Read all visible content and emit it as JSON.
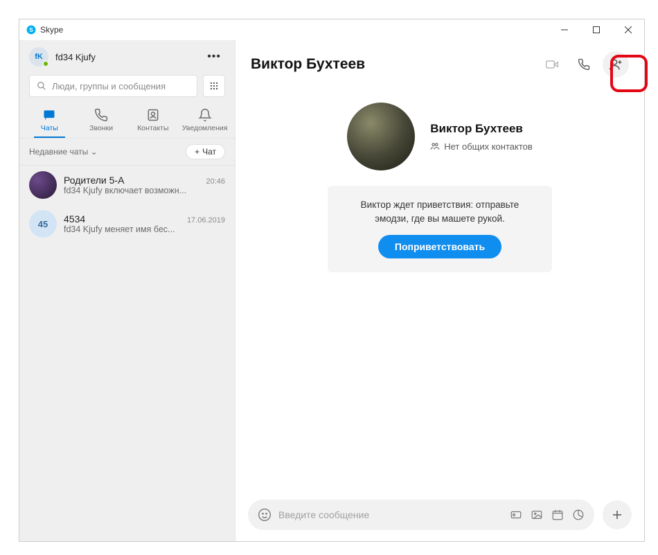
{
  "window": {
    "title": "Skype"
  },
  "sidebar": {
    "user": {
      "initials": "fK",
      "name": "fd34 Kjufy"
    },
    "search_placeholder": "Люди, группы и сообщения",
    "tabs": {
      "chats": "Чаты",
      "calls": "Звонки",
      "contacts": "Контакты",
      "notifications": "Уведомления"
    },
    "recent_label": "Недавние чаты",
    "new_chat_label": "Чат",
    "items": [
      {
        "avatar_text": "",
        "name": "Родители 5-А",
        "time": "20:46",
        "preview": "fd34 Kjufy включает возможн..."
      },
      {
        "avatar_text": "45",
        "name": "4534",
        "time": "17.06.2019",
        "preview": "fd34 Kjufy меняет имя бес..."
      }
    ]
  },
  "main": {
    "title": "Виктор Бухтеев",
    "profile": {
      "name": "Виктор Бухтеев",
      "mutual": "Нет общих контактов"
    },
    "greet_card": {
      "line1": "Виктор ждет приветствия: отправьте",
      "line2": "эмодзи, где вы машете рукой.",
      "button": "Поприветствовать"
    },
    "composer_placeholder": "Введите сообщение"
  }
}
